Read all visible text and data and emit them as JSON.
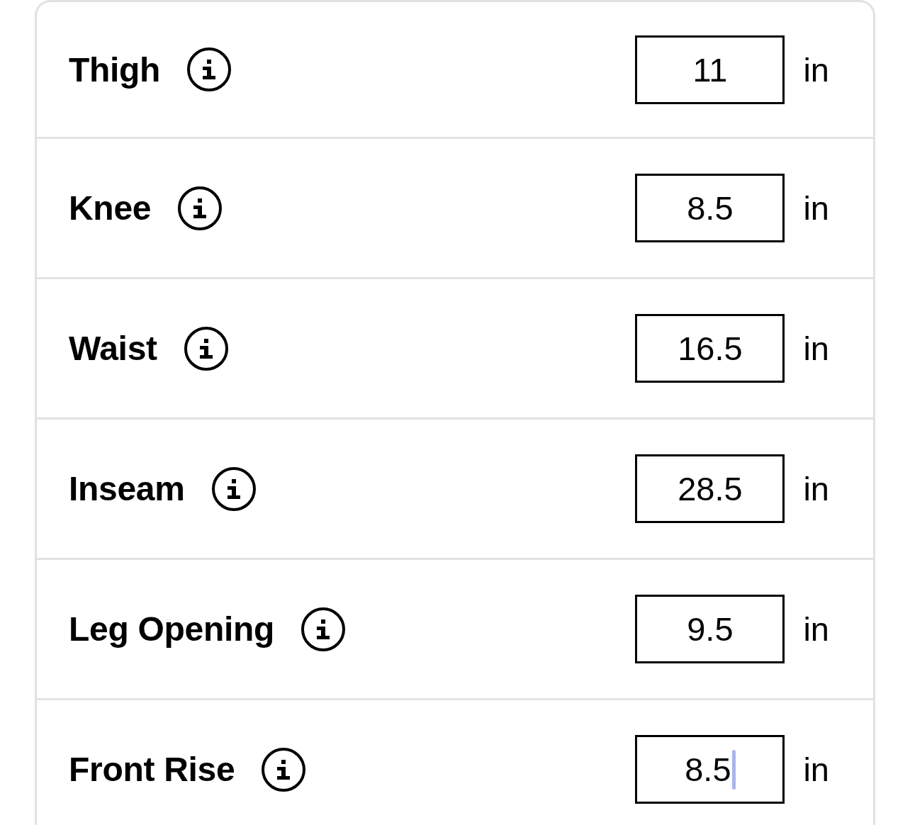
{
  "measurements": [
    {
      "label": "Thigh",
      "value": "11",
      "unit": "in",
      "focused": false
    },
    {
      "label": "Knee",
      "value": "8.5",
      "unit": "in",
      "focused": false
    },
    {
      "label": "Waist",
      "value": "16.5",
      "unit": "in",
      "focused": false
    },
    {
      "label": "Inseam",
      "value": "28.5",
      "unit": "in",
      "focused": false
    },
    {
      "label": "Leg Opening",
      "value": "9.5",
      "unit": "in",
      "focused": false
    },
    {
      "label": "Front Rise",
      "value": "8.5",
      "unit": "in",
      "focused": true
    }
  ]
}
